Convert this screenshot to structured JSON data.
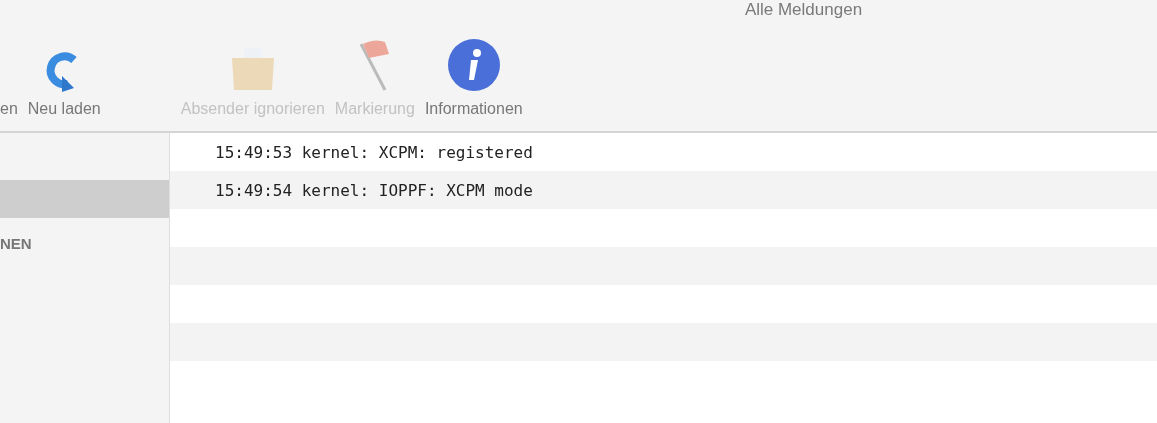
{
  "window": {
    "title": "Alle Meldungen"
  },
  "toolbar": [
    {
      "label": "en",
      "kind": "text",
      "disabled": false
    },
    {
      "label": "Neu laden",
      "kind": "reload",
      "disabled": false
    },
    {
      "label": "Absender ignorieren",
      "kind": "ignore",
      "disabled": true
    },
    {
      "label": "Markierung",
      "kind": "flag",
      "disabled": true
    },
    {
      "label": "Informationen",
      "kind": "info",
      "disabled": false
    }
  ],
  "sidebar": {
    "items": [
      {
        "selected": true
      }
    ],
    "section": "NEN"
  },
  "log": {
    "rows": [
      {
        "text": "15:49:53 kernel: XCPM: registered"
      },
      {
        "text": "15:49:54 kernel: IOPPF: XCPM mode"
      }
    ]
  }
}
